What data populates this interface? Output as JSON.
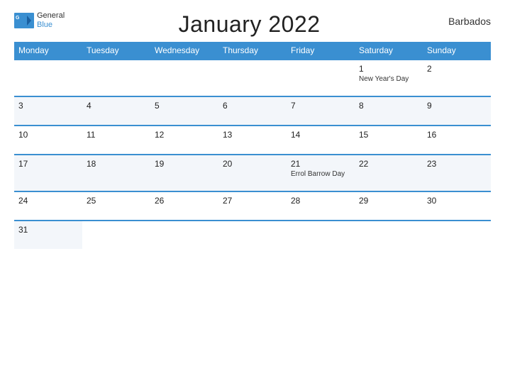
{
  "header": {
    "logo": {
      "line1": "General",
      "line2": "Blue"
    },
    "title": "January 2022",
    "country": "Barbados"
  },
  "weekdays": [
    "Monday",
    "Tuesday",
    "Wednesday",
    "Thursday",
    "Friday",
    "Saturday",
    "Sunday"
  ],
  "weeks": [
    [
      {
        "day": "",
        "holiday": ""
      },
      {
        "day": "",
        "holiday": ""
      },
      {
        "day": "",
        "holiday": ""
      },
      {
        "day": "",
        "holiday": ""
      },
      {
        "day": "",
        "holiday": ""
      },
      {
        "day": "1",
        "holiday": "New Year's Day"
      },
      {
        "day": "2",
        "holiday": ""
      }
    ],
    [
      {
        "day": "3",
        "holiday": ""
      },
      {
        "day": "4",
        "holiday": ""
      },
      {
        "day": "5",
        "holiday": ""
      },
      {
        "day": "6",
        "holiday": ""
      },
      {
        "day": "7",
        "holiday": ""
      },
      {
        "day": "8",
        "holiday": ""
      },
      {
        "day": "9",
        "holiday": ""
      }
    ],
    [
      {
        "day": "10",
        "holiday": ""
      },
      {
        "day": "11",
        "holiday": ""
      },
      {
        "day": "12",
        "holiday": ""
      },
      {
        "day": "13",
        "holiday": ""
      },
      {
        "day": "14",
        "holiday": ""
      },
      {
        "day": "15",
        "holiday": ""
      },
      {
        "day": "16",
        "holiday": ""
      }
    ],
    [
      {
        "day": "17",
        "holiday": ""
      },
      {
        "day": "18",
        "holiday": ""
      },
      {
        "day": "19",
        "holiday": ""
      },
      {
        "day": "20",
        "holiday": ""
      },
      {
        "day": "21",
        "holiday": "Errol Barrow Day"
      },
      {
        "day": "22",
        "holiday": ""
      },
      {
        "day": "23",
        "holiday": ""
      }
    ],
    [
      {
        "day": "24",
        "holiday": ""
      },
      {
        "day": "25",
        "holiday": ""
      },
      {
        "day": "26",
        "holiday": ""
      },
      {
        "day": "27",
        "holiday": ""
      },
      {
        "day": "28",
        "holiday": ""
      },
      {
        "day": "29",
        "holiday": ""
      },
      {
        "day": "30",
        "holiday": ""
      }
    ],
    [
      {
        "day": "31",
        "holiday": ""
      },
      {
        "day": "",
        "holiday": ""
      },
      {
        "day": "",
        "holiday": ""
      },
      {
        "day": "",
        "holiday": ""
      },
      {
        "day": "",
        "holiday": ""
      },
      {
        "day": "",
        "holiday": ""
      },
      {
        "day": "",
        "holiday": ""
      }
    ]
  ],
  "colors": {
    "header_bg": "#3a8fd1",
    "border": "#3a8fd1",
    "row_alt": "#f3f6fa"
  }
}
